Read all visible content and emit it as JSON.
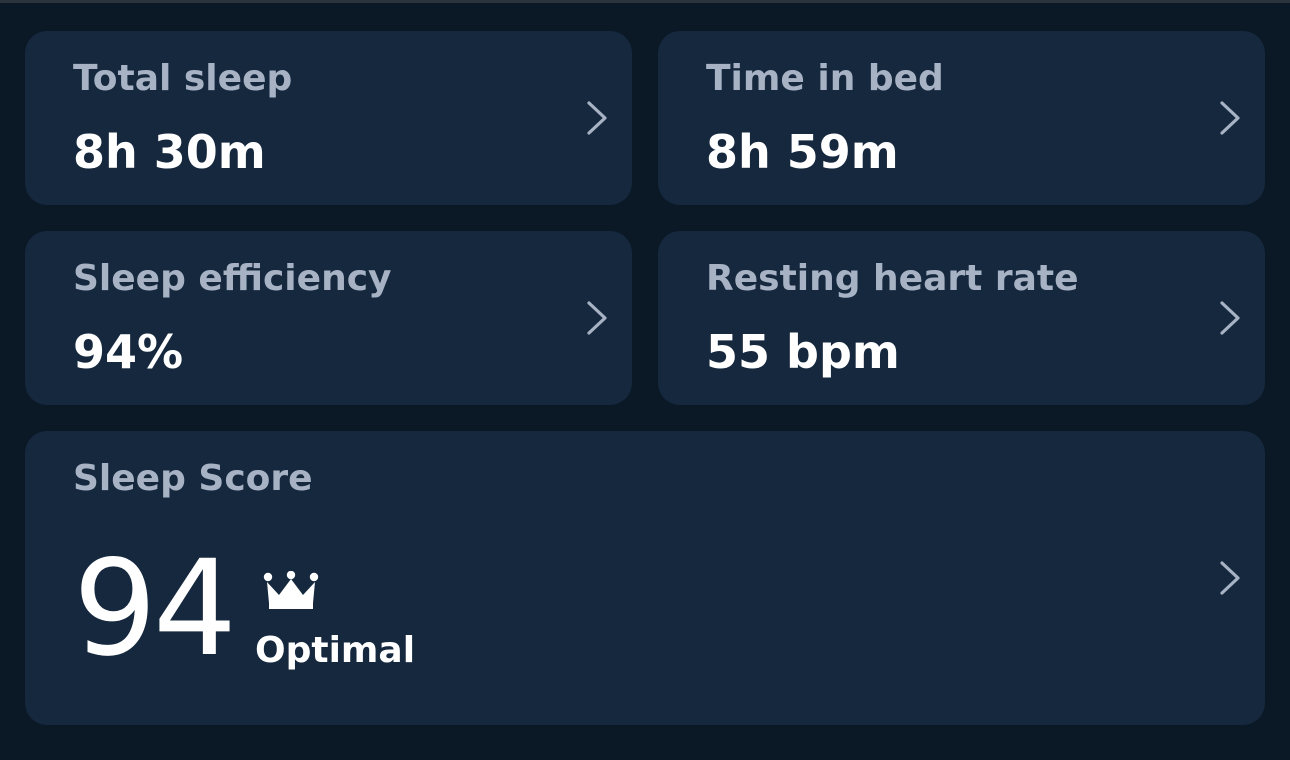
{
  "colors": {
    "background": "#0b1826",
    "card": "#15283e",
    "label": "#a7b3c4",
    "value": "#ffffff"
  },
  "metrics": [
    {
      "label": "Total sleep",
      "value": "8h 30m",
      "icon": "chevron-right-icon"
    },
    {
      "label": "Time in bed",
      "value": "8h 59m",
      "icon": "chevron-right-icon"
    },
    {
      "label": "Sleep efficiency",
      "value": "94%",
      "icon": "chevron-right-icon"
    },
    {
      "label": "Resting heart rate",
      "value": "55 bpm",
      "icon": "chevron-right-icon"
    }
  ],
  "sleep_score": {
    "label": "Sleep Score",
    "value": "94",
    "status": "Optimal",
    "status_icon": "crown-icon",
    "icon": "chevron-right-icon"
  }
}
